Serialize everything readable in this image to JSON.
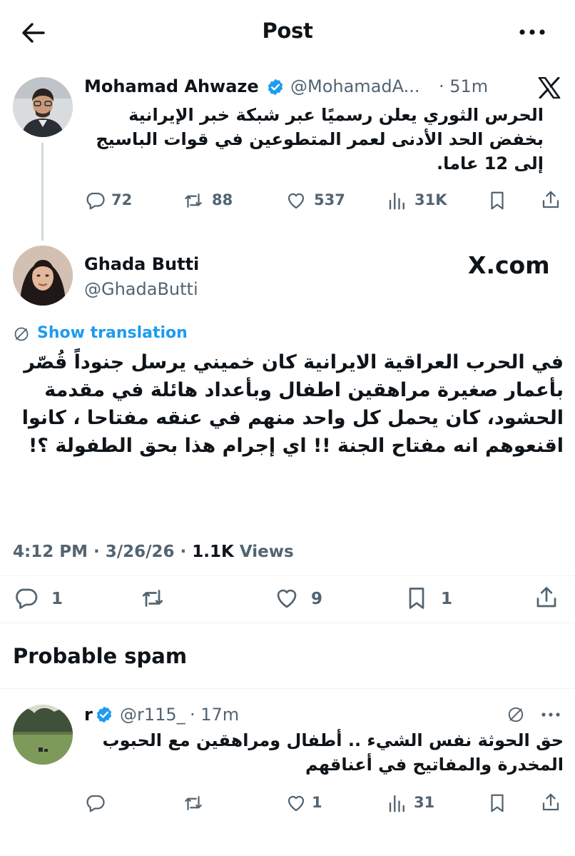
{
  "header": {
    "title": "Post"
  },
  "quoted_tweet": {
    "author_name": "Mohamad Ahwaze",
    "handle": "@MohamadA...",
    "time": "· 51m",
    "text": "الحرس الثوري يعلن رسميًا عبر شبكة خبر الإيرانية بخفض الحد الأدنى لعمر المتطوعين في قوات الباسيج إلى 12 عاما.",
    "replies": "72",
    "reposts": "88",
    "likes": "537",
    "views": "31K"
  },
  "main_tweet": {
    "author_name": "Ghada Butti",
    "handle": "@GhadaButti",
    "source_label": "X.com",
    "show_translation": "Show translation",
    "text": "في الحرب العراقية الايرانية كان خميني يرسل جنوداً قُصّر بأعمار صغيرة مراهقين اطفال وبأعداد هائلة في مقدمة الحشود، كان يحمل كل واحد منهم في عنقه مفتاحا ، كانوا اقنعوهم انه مفتاح الجنة !! اي إجرام هذا بحق الطفولة ؟!",
    "timestamp": "4:12 PM · 3/26/26 · ",
    "views_count": "1.1K",
    "views_label": " Views",
    "replies": "1",
    "likes": "9",
    "bookmarks": "1"
  },
  "spam_section": {
    "title": "Probable spam"
  },
  "reply_tweet": {
    "author_name": "r",
    "handle": "@r115_",
    "time": "· 17m",
    "text": "حق الحوثة نفس الشيء .. أطفال ومراهقين مع الحبوب المخدرة والمفاتيح في أعناقهم",
    "likes": "1",
    "views": "31"
  },
  "colors": {
    "accent": "#1d9bf0",
    "muted": "#536471",
    "text": "#0f1419"
  }
}
